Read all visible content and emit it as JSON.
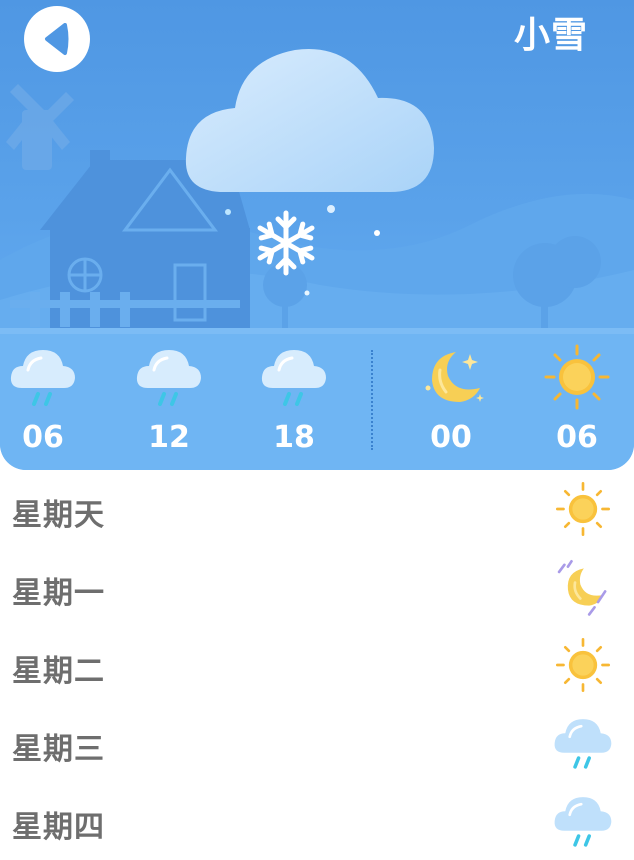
{
  "header": {
    "title": "小雪",
    "back_icon": "back-arrow-icon"
  },
  "current": {
    "condition_icon": "light-snow-icon"
  },
  "hourly": [
    {
      "time": "06",
      "icon": "rain-cloud-icon"
    },
    {
      "time": "12",
      "icon": "rain-cloud-icon"
    },
    {
      "time": "18",
      "icon": "rain-cloud-icon"
    },
    {
      "time": "00",
      "icon": "moon-icon"
    },
    {
      "time": "06",
      "icon": "sun-icon"
    }
  ],
  "daily": [
    {
      "day": "星期天",
      "icon": "sun-icon"
    },
    {
      "day": "星期一",
      "icon": "moon-rain-icon"
    },
    {
      "day": "星期二",
      "icon": "sun-icon"
    },
    {
      "day": "星期三",
      "icon": "rain-cloud-icon"
    },
    {
      "day": "星期四",
      "icon": "rain-cloud-icon"
    }
  ],
  "colors": {
    "sky": "#5aa2ea",
    "sun": "#f7b733",
    "rain": "#3ec6e6",
    "label": "#6e6e6e"
  }
}
